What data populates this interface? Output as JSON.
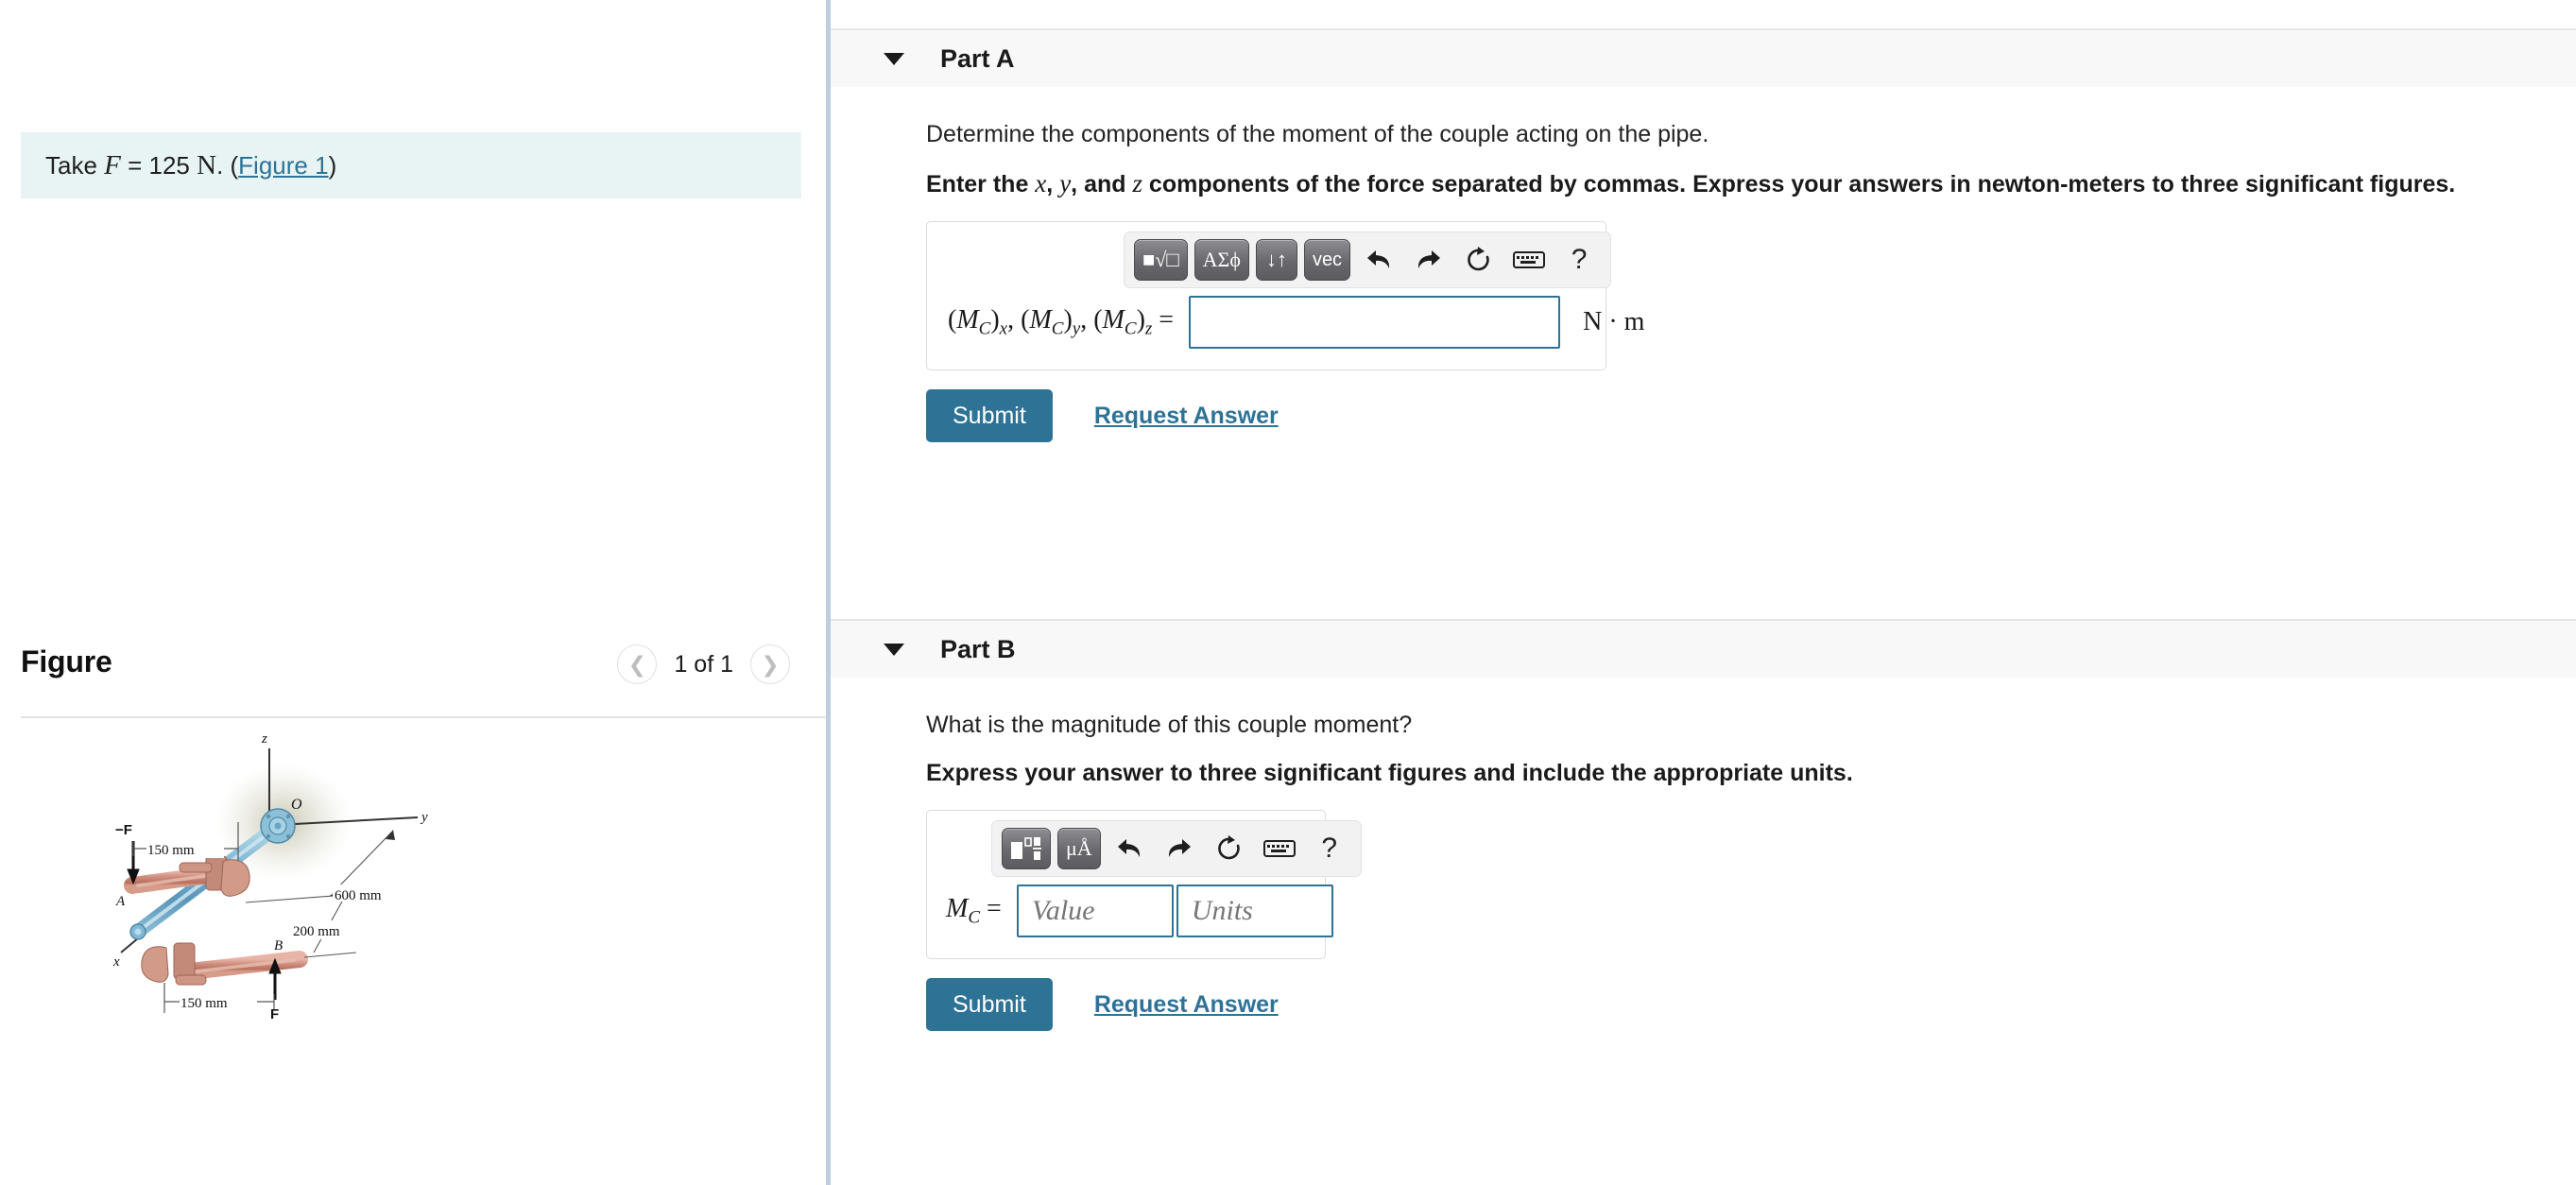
{
  "left": {
    "given": {
      "prefix": "Take ",
      "symbol": "F",
      "equals": " = 125 ",
      "unit": "N",
      "period": ". (",
      "link": "Figure 1",
      "suffix": ")"
    },
    "figure": {
      "title": "Figure",
      "counter": "1 of 1",
      "prev_icon": "chevron-left-icon",
      "next_icon": "chevron-right-icon",
      "labels": {
        "z_axis": "z",
        "y_axis": "y",
        "x_axis": "x",
        "origin": "O",
        "point_a": "A",
        "point_b": "B",
        "force_up": "F",
        "force_down": "-F",
        "dim_top": "150 mm",
        "dim_bottom": "150 mm",
        "dim_600": "600 mm",
        "dim_200": "200 mm"
      }
    }
  },
  "parts": [
    {
      "id": "a",
      "title": "Part A",
      "question": "Determine the components of the moment of the couple acting on the pipe.",
      "instruction_pre": "Enter the ",
      "instruction_vars": [
        "x",
        "y",
        "z"
      ],
      "instruction_post": " components of the force separated by commas. Express your answers in newton-meters to three significant figures.",
      "instruction_full": "Enter the x, y, and z components of the force separated by commas. Express your answers in newton-meters to three significant figures.",
      "toolbar": {
        "buttons": [
          {
            "name": "template-sqrt-button",
            "label": "■√□"
          },
          {
            "name": "greek-symbols-button",
            "label": "ΑΣϕ"
          },
          {
            "name": "updown-arrows-button",
            "label": "↓↑"
          },
          {
            "name": "vector-button",
            "label": "vec"
          }
        ],
        "icons": [
          {
            "name": "undo-icon",
            "glyph": "↰"
          },
          {
            "name": "redo-icon",
            "glyph": "↱"
          },
          {
            "name": "reset-icon",
            "glyph": "↺"
          },
          {
            "name": "keyboard-icon",
            "glyph": "⌨"
          },
          {
            "name": "help-icon",
            "glyph": "?"
          }
        ]
      },
      "field": {
        "label_html": "(M_C)_x, (M_C)_y, (M_C)_z =",
        "value": "",
        "placeholder": "",
        "units_suffix": "N · m"
      },
      "submit_label": "Submit",
      "request_label": "Request Answer"
    },
    {
      "id": "b",
      "title": "Part B",
      "question": "What is the magnitude of this couple moment?",
      "instruction_full": "Express your answer to three significant figures and include the appropriate units.",
      "toolbar": {
        "buttons": [
          {
            "name": "template-fraction-button",
            "label": "■□"
          },
          {
            "name": "units-button",
            "label": "μÅ"
          }
        ],
        "icons": [
          {
            "name": "undo-icon",
            "glyph": "↰"
          },
          {
            "name": "redo-icon",
            "glyph": "↱"
          },
          {
            "name": "reset-icon",
            "glyph": "↺"
          },
          {
            "name": "keyboard-icon",
            "glyph": "⌨"
          },
          {
            "name": "help-icon",
            "glyph": "?"
          }
        ]
      },
      "field": {
        "label_main": "M",
        "label_sub": "C",
        "label_eq": " =",
        "value_placeholder": "Value",
        "units_placeholder": "Units"
      },
      "submit_label": "Submit",
      "request_label": "Request Answer"
    }
  ],
  "colors": {
    "accent": "#2e7296",
    "given_bg": "#e8f4f4",
    "part_header_bg": "#f8f8f8",
    "divider": "#bdcede"
  }
}
